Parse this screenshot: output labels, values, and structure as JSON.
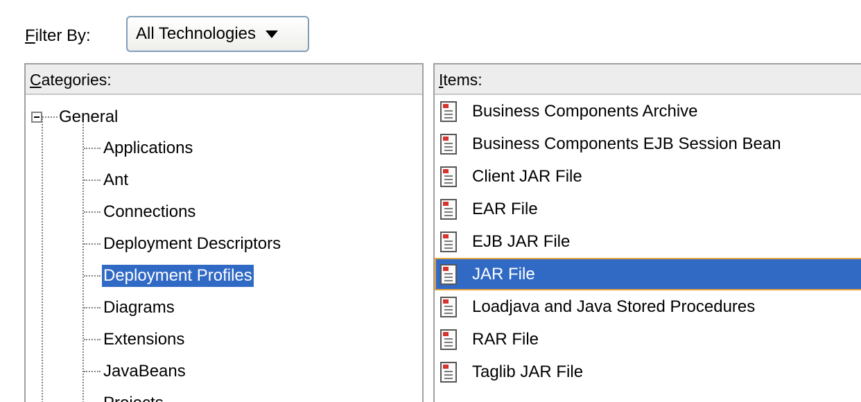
{
  "filter": {
    "label_mnemonic": "F",
    "label_rest": "ilter By:",
    "selected": "All Technologies"
  },
  "categories": {
    "header_mnemonic": "C",
    "header_rest": "ategories:",
    "root": "General",
    "children": [
      "Applications",
      "Ant",
      "Connections",
      "Deployment Descriptors",
      "Deployment Profiles",
      "Diagrams",
      "Extensions",
      "JavaBeans",
      "Projects"
    ],
    "selected": "Deployment Profiles"
  },
  "items": {
    "header_mnemonic": "I",
    "header_rest": "tems:",
    "list": [
      "Business Components Archive",
      "Business Components EJB Session Bean",
      "Client JAR File",
      "EAR File",
      "EJB JAR File",
      "JAR File",
      "Loadjava and Java Stored Procedures",
      "RAR File",
      "Taglib JAR File"
    ],
    "selected": "JAR File"
  },
  "colors": {
    "selection": "#316ac5",
    "focus_border": "#e6a23a"
  }
}
